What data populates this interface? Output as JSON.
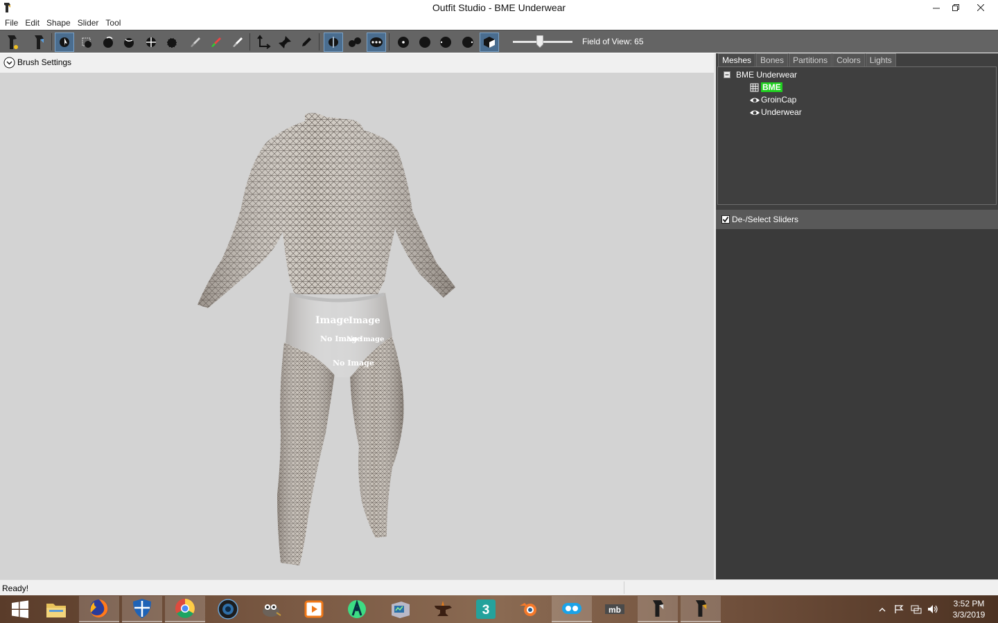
{
  "window": {
    "title": "Outfit Studio - BME Underwear"
  },
  "menu": [
    "File",
    "Edit",
    "Shape",
    "Slider",
    "Tool"
  ],
  "toolbar": {
    "field_of_view_label": "Field of View: 65",
    "field_of_view": 65
  },
  "viewport": {
    "brush_settings_label": "Brush Settings",
    "texture_placeholder_text": [
      "No Image",
      "Image",
      "Image",
      "No Image",
      "No Image",
      "No Image",
      "No Image"
    ]
  },
  "panel": {
    "tabs": [
      "Meshes",
      "Bones",
      "Partitions",
      "Colors",
      "Lights"
    ],
    "active_tab": "Meshes",
    "tree_root": "BME Underwear",
    "meshes": [
      {
        "name": "BME",
        "icon": "wireframe-icon",
        "selected": true
      },
      {
        "name": "GroinCap",
        "icon": "eye-icon",
        "selected": false
      },
      {
        "name": "Underwear",
        "icon": "eye-icon",
        "selected": false
      }
    ],
    "slider_header": "De-/Select Sliders"
  },
  "status": {
    "text": "Ready!"
  },
  "taskbar": {
    "apps": [
      "windows-start",
      "file-explorer",
      "firefox",
      "windows-defender",
      "chrome",
      "camera-app",
      "gimp",
      "media-player",
      "android-studio",
      "vm-app",
      "anvil-app",
      "3ds-max",
      "blender",
      "messenger-app",
      "mb-app",
      "outfit-studio-1",
      "outfit-studio-2"
    ],
    "time": "3:52 PM",
    "date": "3/3/2019"
  },
  "colors": {
    "toolbar_bg": "#646464",
    "viewport_bg": "#d3d3d3",
    "panel_bg": "#3f3f3f",
    "selected_mesh": "#20d020",
    "active_button": "#4a6d8f"
  }
}
